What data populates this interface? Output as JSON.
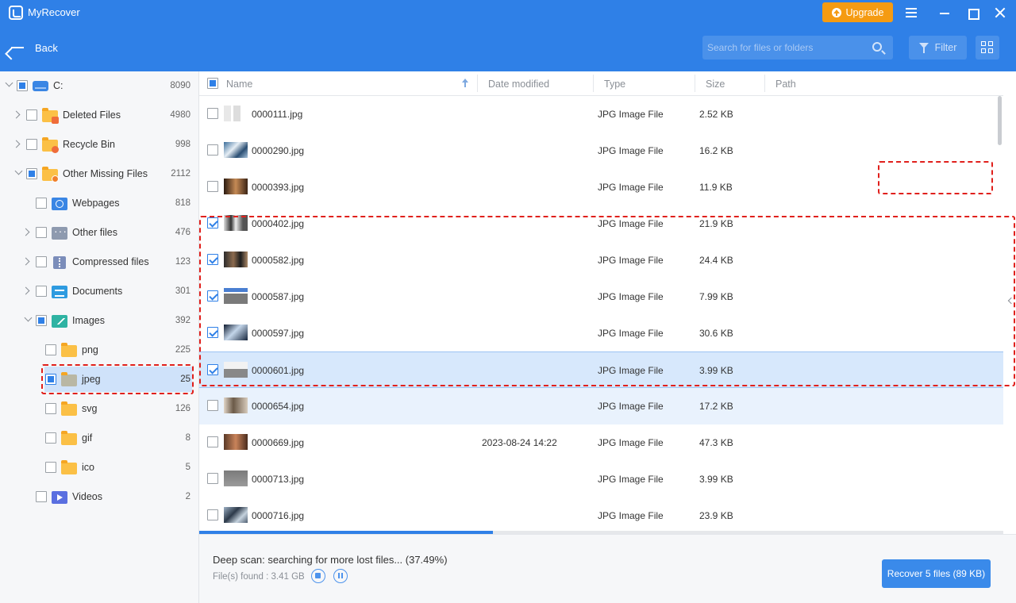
{
  "app": {
    "title": "MyRecover",
    "upgrade_label": "Upgrade"
  },
  "toolbar": {
    "back_label": "Back",
    "search_placeholder": "Search for files or folders",
    "filter_label": "Filter"
  },
  "sidebar": {
    "root": {
      "label": "C:",
      "count": "8090"
    },
    "items": [
      {
        "label": "Deleted Files",
        "count": "4980"
      },
      {
        "label": "Recycle Bin",
        "count": "998"
      },
      {
        "label": "Other Missing Files",
        "count": "2112"
      },
      {
        "label": "Webpages",
        "count": "818"
      },
      {
        "label": "Other files",
        "count": "476"
      },
      {
        "label": "Compressed files",
        "count": "123"
      },
      {
        "label": "Documents",
        "count": "301"
      },
      {
        "label": "Images",
        "count": "392"
      },
      {
        "label": "png",
        "count": "225"
      },
      {
        "label": "jpeg",
        "count": "25"
      },
      {
        "label": "svg",
        "count": "126"
      },
      {
        "label": "gif",
        "count": "8"
      },
      {
        "label": "ico",
        "count": "5"
      },
      {
        "label": "Videos",
        "count": "2"
      }
    ]
  },
  "columns": {
    "name": "Name",
    "date": "Date modified",
    "type": "Type",
    "size": "Size",
    "path": "Path"
  },
  "files": [
    {
      "name": "0000111.jpg",
      "date": "",
      "type": "JPG Image File",
      "size": "2.52 KB",
      "checked": false
    },
    {
      "name": "0000290.jpg",
      "date": "",
      "type": "JPG Image File",
      "size": "16.2 KB",
      "checked": false
    },
    {
      "name": "0000393.jpg",
      "date": "",
      "type": "JPG Image File",
      "size": "11.9 KB",
      "checked": false
    },
    {
      "name": "0000402.jpg",
      "date": "",
      "type": "JPG Image File",
      "size": "21.9 KB",
      "checked": true
    },
    {
      "name": "0000582.jpg",
      "date": "",
      "type": "JPG Image File",
      "size": "24.4 KB",
      "checked": true
    },
    {
      "name": "0000587.jpg",
      "date": "",
      "type": "JPG Image File",
      "size": "7.99 KB",
      "checked": true
    },
    {
      "name": "0000597.jpg",
      "date": "",
      "type": "JPG Image File",
      "size": "30.6 KB",
      "checked": true
    },
    {
      "name": "0000601.jpg",
      "date": "",
      "type": "JPG Image File",
      "size": "3.99 KB",
      "checked": true
    },
    {
      "name": "0000654.jpg",
      "date": "",
      "type": "JPG Image File",
      "size": "17.2 KB",
      "checked": false
    },
    {
      "name": "0000669.jpg",
      "date": "2023-08-24 14:22",
      "type": "JPG Image File",
      "size": "47.3 KB",
      "checked": false
    },
    {
      "name": "0000713.jpg",
      "date": "",
      "type": "JPG Image File",
      "size": "3.99 KB",
      "checked": false
    },
    {
      "name": "0000716.jpg",
      "date": "",
      "type": "JPG Image File",
      "size": "23.9 KB",
      "checked": false
    }
  ],
  "status": {
    "scan_text": "Deep scan: searching for more lost files... (37.49%)",
    "progress_percent": 37.49,
    "found_text": "File(s) found : 3.41 GB",
    "recover_label": "Recover 5 files (89 KB)"
  },
  "colors": {
    "accent": "#2f80e7",
    "upgrade": "#f59b12",
    "annotation": "#e0201c"
  }
}
